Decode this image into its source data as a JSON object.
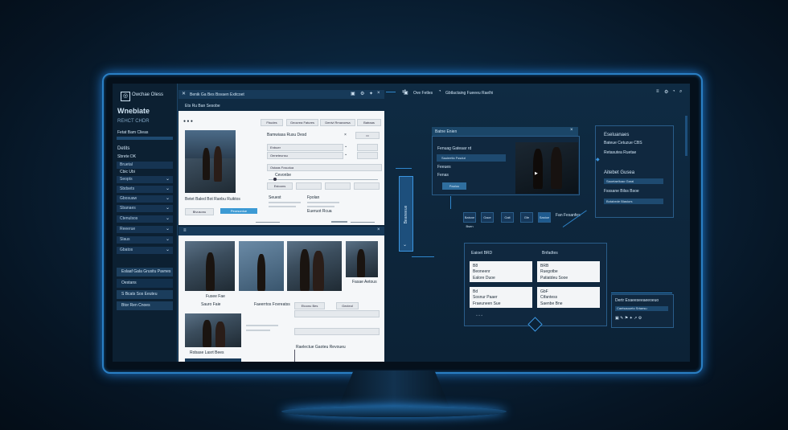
{
  "sidebar": {
    "logo_text": "Owchae Oless",
    "title": "Wnebiate",
    "subtitle": "REHCT CHDR",
    "desc": "Fetat Bam Clieas",
    "section": "Detits",
    "section_sub": "Sbrete DK",
    "filter_label": "Bruetal",
    "filter_sub": "Cbic Ubi",
    "items": [
      {
        "label": "Seopts"
      },
      {
        "label": "Sbdsets"
      },
      {
        "label": "Gbosuaw"
      },
      {
        "label": "Sbanaes"
      },
      {
        "label": "Ctenulsos"
      },
      {
        "label": "Reeerue"
      },
      {
        "label": "Slaus"
      },
      {
        "label": "Gbatos"
      }
    ],
    "buttons": [
      {
        "label": "Eslaaf Gala Grusitu Pavnes"
      },
      {
        "label": "Oestans"
      },
      {
        "label": "S Bcats Sos Eeuteu"
      },
      {
        "label": "Btor Ren Cnoes"
      }
    ]
  },
  "main_top": {
    "title": "Benik Ga Bes Bsvaen Exitcoet",
    "breadcrumb": "Ets Ru Ban Sesobe",
    "toolbar": [
      "Fbudes",
      "Geocrea Fatures",
      "Denivi Rmavoesa",
      "Batraas"
    ],
    "form_title": "Bamwiasa Rusu Desd",
    "fields": [
      "Enbuer",
      "Oeneteunsu",
      "Ostaas Fcsudua",
      "Cevonbe",
      "Estoons"
    ],
    "pill": "Raoutie Son",
    "caption": "Betet Baled Bot Ranbu Ruiktos",
    "actions": [
      "Blvusonu",
      "Peorsonlue"
    ],
    "checks": [
      "Seuest",
      "Fpolan",
      "Eueruot Rcua"
    ]
  },
  "main_bottom": {
    "photos": [
      {
        "caption": "Fusee Fae"
      },
      {
        "caption": "Sauro Faie"
      },
      {
        "caption": "Faeerrtos Fovreatss"
      }
    ],
    "side_labels": [
      "Fasae Aetous",
      "Etoonu Bes",
      "Gecteol"
    ],
    "bottom_caption": "Robase Lasrt Bees",
    "bottom_title": "Raelectue Gaoteu Revoueu"
  },
  "connector": {
    "label": "Beaneeue"
  },
  "right_top": {
    "header": "Ove Fetles",
    "header_desc": "Gbtlactaing Fueeeu Raelhi",
    "video_title": "Batne Enien",
    "video_menu_title": "Fenuag Gateaar rd",
    "video_menu": [
      "Sauieetio Fssdut",
      "Feeues",
      "Fenas"
    ],
    "play_label": "Paaluu",
    "controls": [
      "Batsne Bsen",
      "Gace",
      "Gait",
      "Gfe",
      "Sastoe",
      "Fan Fesanfes"
    ],
    "info_title": "Eseluanaes",
    "info_sub": "Bateue Cetuzue CBS",
    "info_desc": "Retasutea Ruetae",
    "info_section": "Aitebet Gusea",
    "info_rows": [
      "Saoetaelluao Garal",
      "Fsssane Bilss Bsoe",
      "Botabede Blasiurs"
    ]
  },
  "right_bottom": {
    "title": "Eaioet BRD",
    "title2": "Bnfadtes",
    "cards": [
      {
        "code": "B8",
        "name": "Beoneenr",
        "line": "Ealore Duoe"
      },
      {
        "code": "BRB",
        "name": "Ruegotbe",
        "line": "Patiatdeu Sooe"
      },
      {
        "code": "Bd",
        "name": "Sosnur Paaer",
        "line": "Fraeuneen Sue"
      },
      {
        "code": "GbF",
        "name": "Ctfantess",
        "line": "Saenbe Bne"
      }
    ],
    "side_title": "Dertr Exaeeseeaeeoeuo",
    "side_sub": "Caetsauueto Srtaesu"
  },
  "topbar_right": {
    "icons": [
      "menu-icon",
      "gear-icon",
      "clock-icon",
      "search-icon"
    ]
  },
  "colors": {
    "accent": "#2f86cc",
    "panel": "#10283f",
    "button_blue": "#3c9ad4"
  }
}
